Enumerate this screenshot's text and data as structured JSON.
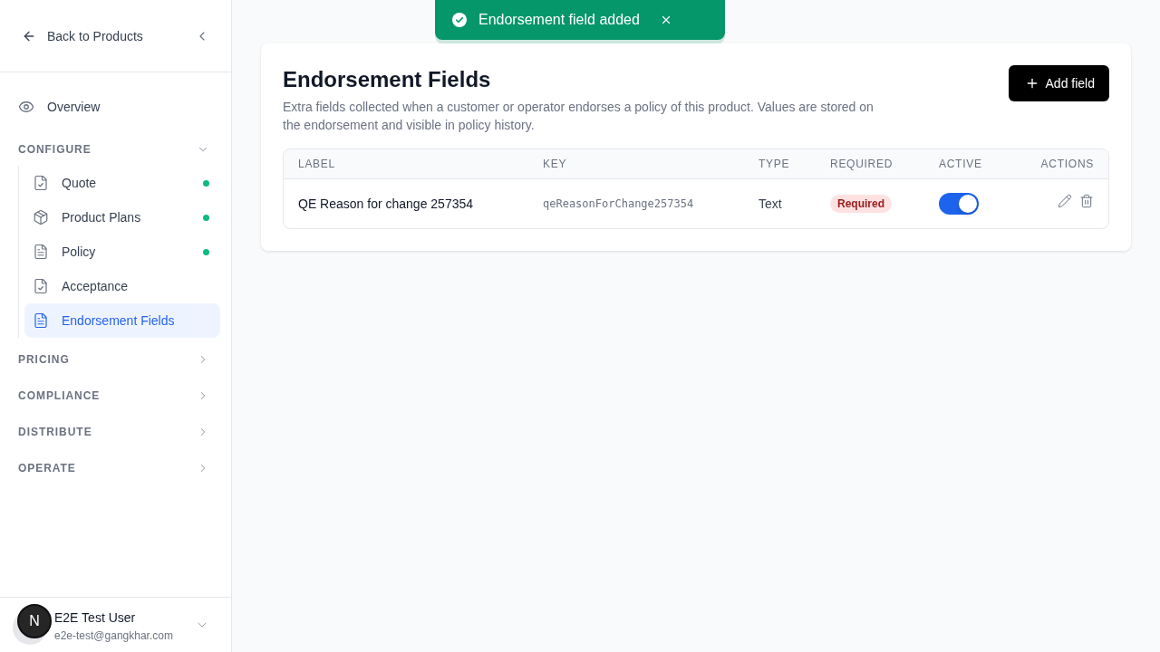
{
  "toast": {
    "message": "Endorsement field added"
  },
  "sidebar": {
    "back_link": "Back to Products",
    "overview": {
      "label": "Overview",
      "selected": false
    },
    "sections": [
      {
        "title": "CONFIGURE",
        "expanded": true,
        "items": [
          {
            "label": "Quote",
            "selected": false,
            "completed": true
          },
          {
            "label": "Product Plans",
            "selected": false,
            "completed": true
          },
          {
            "label": "Policy",
            "selected": false,
            "completed": true
          },
          {
            "label": "Acceptance",
            "selected": false,
            "completed": false
          },
          {
            "label": "Endorsement Fields",
            "selected": true,
            "completed": false
          }
        ]
      },
      {
        "title": "PRICING",
        "expanded": false
      },
      {
        "title": "COMPLIANCE",
        "expanded": false
      },
      {
        "title": "DISTRIBUTE",
        "expanded": false
      },
      {
        "title": "OPERATE",
        "expanded": false
      }
    ],
    "user": {
      "initial": "N",
      "name": "E2E Test User",
      "email": "e2e-test@gangkhar.com"
    }
  },
  "page": {
    "title": "Endorsement Fields",
    "description": "Extra fields collected when a customer or operator endorses a policy of this product. Values are stored on the endorsement and visible in policy history.",
    "add_button": "Add field",
    "table": {
      "columns": [
        "LABEL",
        "KEY",
        "TYPE",
        "REQUIRED",
        "ACTIVE",
        "ACTIONS"
      ],
      "rows": [
        {
          "label": "QE Reason for change 257354",
          "key": "qeReasonForChange257354",
          "type": "Text",
          "required": "Required",
          "active": true
        }
      ]
    }
  }
}
